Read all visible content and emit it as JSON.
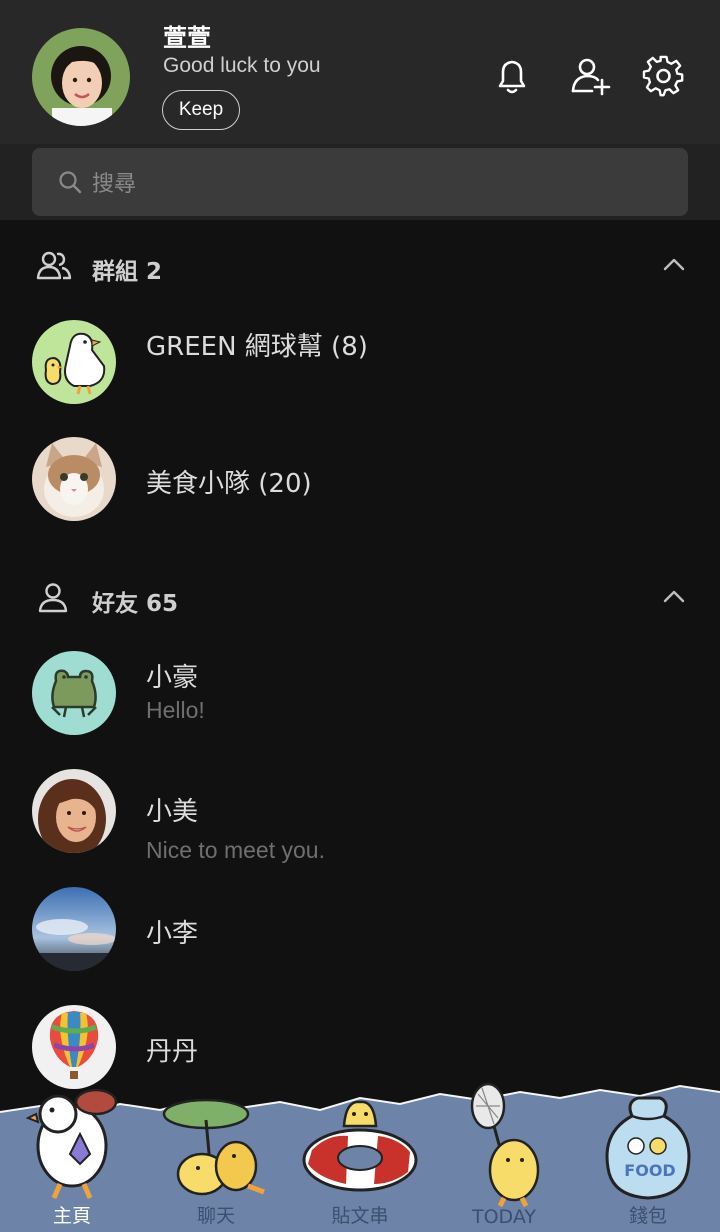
{
  "profile": {
    "name": "萱萱",
    "status": "Good luck to you",
    "keep_label": "Keep"
  },
  "search": {
    "placeholder": "搜尋"
  },
  "groups_section": {
    "title": "群組 2"
  },
  "groups": [
    {
      "name": "GREEN 網球幫 (8)"
    },
    {
      "name": "美食小隊 (20)"
    }
  ],
  "friends_section": {
    "title": "好友 65"
  },
  "friends": [
    {
      "name": "小豪",
      "status": "Hello!"
    },
    {
      "name": "小美",
      "status": "Nice to meet you."
    },
    {
      "name": "小李",
      "status": ""
    },
    {
      "name": "丹丹",
      "status": ""
    }
  ],
  "tabs": [
    {
      "label": "主頁",
      "icon": "duck-home-icon",
      "active": true
    },
    {
      "label": "聊天",
      "icon": "ducks-chat-icon",
      "active": false
    },
    {
      "label": "貼文串",
      "icon": "duck-float-icon",
      "active": false
    },
    {
      "label": "TODAY",
      "icon": "duck-net-icon",
      "active": false
    },
    {
      "label": "錢包",
      "icon": "food-bag-icon",
      "active": false
    }
  ],
  "colors": {
    "header_bg": "#282828",
    "list_bg": "#111111",
    "tabbar_bg": "#6d84a8",
    "search_bg": "#3b3b3b"
  }
}
